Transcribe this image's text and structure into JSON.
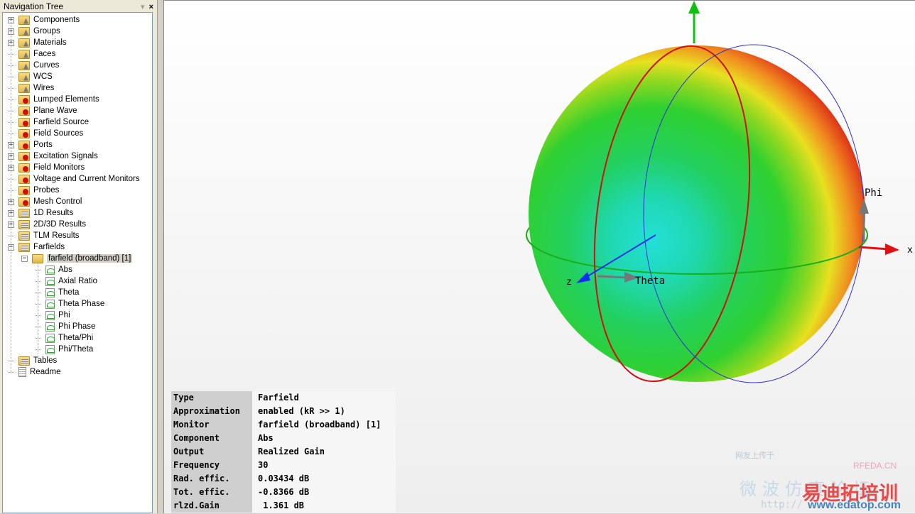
{
  "panel": {
    "title": "Navigation Tree",
    "pin": "▾",
    "close": "×"
  },
  "tree": [
    {
      "label": "Components",
      "level": 0,
      "exp": "+",
      "icon": "folder"
    },
    {
      "label": "Groups",
      "level": 0,
      "exp": "+",
      "icon": "folder"
    },
    {
      "label": "Materials",
      "level": 0,
      "exp": "+",
      "icon": "folder"
    },
    {
      "label": "Faces",
      "level": 0,
      "exp": "",
      "icon": "folder"
    },
    {
      "label": "Curves",
      "level": 0,
      "exp": "",
      "icon": "folder"
    },
    {
      "label": "WCS",
      "level": 0,
      "exp": "",
      "icon": "folder"
    },
    {
      "label": "Wires",
      "level": 0,
      "exp": "",
      "icon": "folder"
    },
    {
      "label": "Lumped Elements",
      "level": 0,
      "exp": "",
      "icon": "gear"
    },
    {
      "label": "Plane Wave",
      "level": 0,
      "exp": "",
      "icon": "gear"
    },
    {
      "label": "Farfield Source",
      "level": 0,
      "exp": "",
      "icon": "gear"
    },
    {
      "label": "Field Sources",
      "level": 0,
      "exp": "",
      "icon": "gear"
    },
    {
      "label": "Ports",
      "level": 0,
      "exp": "+",
      "icon": "gear"
    },
    {
      "label": "Excitation Signals",
      "level": 0,
      "exp": "+",
      "icon": "gear"
    },
    {
      "label": "Field Monitors",
      "level": 0,
      "exp": "+",
      "icon": "gear"
    },
    {
      "label": "Voltage and Current Monitors",
      "level": 0,
      "exp": "",
      "icon": "gear"
    },
    {
      "label": "Probes",
      "level": 0,
      "exp": "",
      "icon": "gear"
    },
    {
      "label": "Mesh Control",
      "level": 0,
      "exp": "+",
      "icon": "gear"
    },
    {
      "label": "1D Results",
      "level": 0,
      "exp": "+",
      "icon": "stack"
    },
    {
      "label": "2D/3D Results",
      "level": 0,
      "exp": "+",
      "icon": "stack"
    },
    {
      "label": "TLM Results",
      "level": 0,
      "exp": "",
      "icon": "stack"
    },
    {
      "label": "Farfields",
      "level": 0,
      "exp": "−",
      "icon": "stack"
    },
    {
      "label": "farfield (broadband) [1]",
      "level": 1,
      "exp": "−",
      "icon": "plain",
      "selected": true
    },
    {
      "label": "Abs",
      "level": 2,
      "exp": "",
      "icon": "plot"
    },
    {
      "label": "Axial Ratio",
      "level": 2,
      "exp": "",
      "icon": "plot"
    },
    {
      "label": "Theta",
      "level": 2,
      "exp": "",
      "icon": "plot"
    },
    {
      "label": "Theta Phase",
      "level": 2,
      "exp": "",
      "icon": "plot"
    },
    {
      "label": "Phi",
      "level": 2,
      "exp": "",
      "icon": "plot"
    },
    {
      "label": "Phi Phase",
      "level": 2,
      "exp": "",
      "icon": "plot"
    },
    {
      "label": "Theta/Phi",
      "level": 2,
      "exp": "",
      "icon": "plot"
    },
    {
      "label": "Phi/Theta",
      "level": 2,
      "exp": "",
      "icon": "plot"
    },
    {
      "label": "Tables",
      "level": 0,
      "exp": "",
      "icon": "stack"
    },
    {
      "label": "Readme",
      "level": 0,
      "exp": "",
      "icon": "doc"
    }
  ],
  "axes": {
    "phi": "Phi",
    "theta": "Theta",
    "x": "x",
    "z": "z"
  },
  "info": [
    {
      "k": "Type",
      "v": "Farfield"
    },
    {
      "k": "Approximation",
      "v": "enabled (kR >> 1)"
    },
    {
      "k": "Monitor",
      "v": "farfield (broadband) [1]"
    },
    {
      "k": "Component",
      "v": "Abs"
    },
    {
      "k": "Output",
      "v": "Realized Gain"
    },
    {
      "k": "Frequency",
      "v": "30"
    },
    {
      "k": "Rad. effic.",
      "v": "0.03434 dB"
    },
    {
      "k": "Tot. effic.",
      "v": "-0.8366 dB"
    },
    {
      "k": "rlzd.Gain",
      "v": " 1.361 dB"
    }
  ],
  "watermark": {
    "brand": "RFEDA.CN",
    "cn1": "微波仿真论坛",
    "cn2": "易迪拓培训",
    "url": "www.edatop.com",
    "http": "http://",
    "top": "网友上传于"
  },
  "colors": {
    "x_axis": "#e01010",
    "y_axis": "#10c010",
    "z_axis": "#1030f0"
  }
}
